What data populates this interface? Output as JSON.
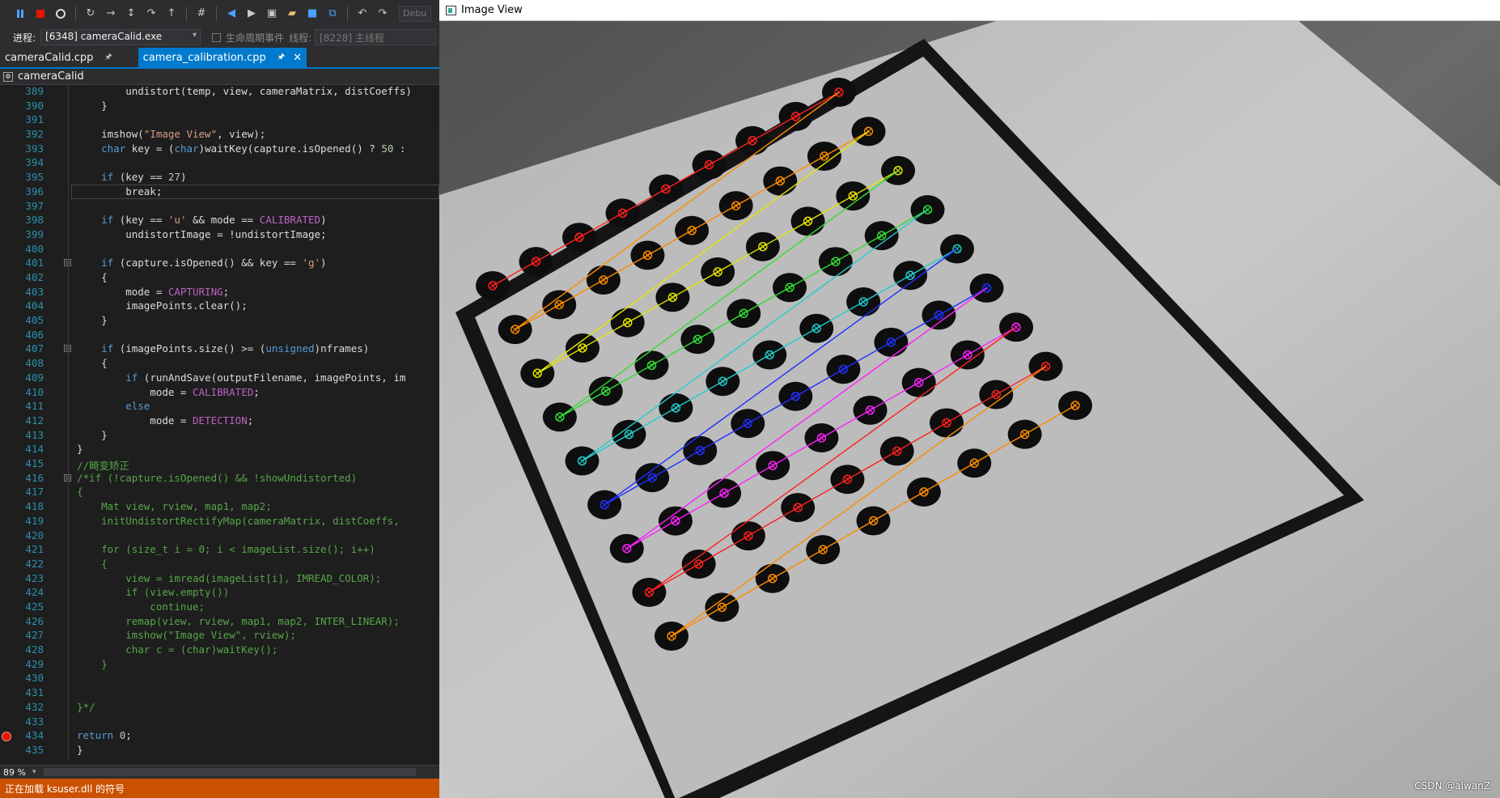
{
  "toolbar": {
    "icons": [
      "pause-icon",
      "stop-icon",
      "restart-icon",
      "show-next-statement-icon",
      "step-into-icon",
      "step-over-icon",
      "step-out-icon",
      "hex-icon",
      "navigate-back-icon",
      "navigate-forward-icon",
      "new-project-icon",
      "open-file-icon",
      "save-icon",
      "save-all-icon",
      "undo-icon",
      "redo-icon"
    ],
    "config_value": "Debu"
  },
  "process_bar": {
    "process_label": "进程:",
    "process_value": "[6348] cameraCalid.exe",
    "lifecycle_label": "生命周期事件",
    "thread_label": "线程:",
    "thread_value": "[8228] 主线程"
  },
  "tabs": [
    {
      "label": "cameraCalid.cpp",
      "active": false
    },
    {
      "label": "camera_calibration.cpp",
      "active": true
    }
  ],
  "navbar": {
    "scope": "cameraCalid"
  },
  "editor": {
    "lines": [
      {
        "n": "389",
        "text": "        undistort(temp, view, cameraMatrix, distCoeffs)"
      },
      {
        "n": "390",
        "text": "    }"
      },
      {
        "n": "391",
        "text": ""
      },
      {
        "n": "392",
        "text": "    imshow(\"Image View\", view);"
      },
      {
        "n": "393",
        "text": "    char key = (char)waitKey(capture.isOpened() ? 50 :"
      },
      {
        "n": "394",
        "text": ""
      },
      {
        "n": "395",
        "text": "    if (key == 27)"
      },
      {
        "n": "396",
        "text": "        break;"
      },
      {
        "n": "397",
        "text": ""
      },
      {
        "n": "398",
        "text": "    if (key == 'u' && mode == CALIBRATED)"
      },
      {
        "n": "399",
        "text": "        undistortImage = !undistortImage;"
      },
      {
        "n": "400",
        "text": ""
      },
      {
        "n": "401",
        "text": "    if (capture.isOpened() && key == 'g')"
      },
      {
        "n": "402",
        "text": "    {"
      },
      {
        "n": "403",
        "text": "        mode = CAPTURING;"
      },
      {
        "n": "404",
        "text": "        imagePoints.clear();"
      },
      {
        "n": "405",
        "text": "    }"
      },
      {
        "n": "406",
        "text": ""
      },
      {
        "n": "407",
        "text": "    if (imagePoints.size() >= (unsigned)nframes)"
      },
      {
        "n": "408",
        "text": "    {"
      },
      {
        "n": "409",
        "text": "        if (runAndSave(outputFilename, imagePoints, im"
      },
      {
        "n": "410",
        "text": "            mode = CALIBRATED;"
      },
      {
        "n": "411",
        "text": "        else"
      },
      {
        "n": "412",
        "text": "            mode = DETECTION;"
      },
      {
        "n": "413",
        "text": "    }"
      },
      {
        "n": "414",
        "text": "}"
      },
      {
        "n": "415",
        "text": "//畸变矫正"
      },
      {
        "n": "416",
        "text": "/*if (!capture.isOpened() && !showUndistorted)"
      },
      {
        "n": "417",
        "text": "{"
      },
      {
        "n": "418",
        "text": "    Mat view, rview, map1, map2;"
      },
      {
        "n": "419",
        "text": "    initUndistortRectifyMap(cameraMatrix, distCoeffs,"
      },
      {
        "n": "420",
        "text": ""
      },
      {
        "n": "421",
        "text": "    for (size_t i = 0; i < imageList.size(); i++)"
      },
      {
        "n": "422",
        "text": "    {"
      },
      {
        "n": "423",
        "text": "        view = imread(imageList[i], IMREAD_COLOR);"
      },
      {
        "n": "424",
        "text": "        if (view.empty())"
      },
      {
        "n": "425",
        "text": "            continue;"
      },
      {
        "n": "426",
        "text": "        remap(view, rview, map1, map2, INTER_LINEAR);"
      },
      {
        "n": "427",
        "text": "        imshow(\"Image View\", rview);"
      },
      {
        "n": "428",
        "text": "        char c = (char)waitKey();"
      },
      {
        "n": "429",
        "text": "    }"
      },
      {
        "n": "430",
        "text": ""
      },
      {
        "n": "431",
        "text": ""
      },
      {
        "n": "432",
        "text": "}*/"
      },
      {
        "n": "433",
        "text": ""
      },
      {
        "n": "434",
        "text": "return 0;"
      },
      {
        "n": "435",
        "text": "}"
      }
    ]
  },
  "zoom": {
    "value": "89 %"
  },
  "status": {
    "text": "正在加载 ksuser.dll 的符号"
  },
  "image_window": {
    "title": "Image View",
    "watermark": "CSDN @alwanZ",
    "row_colors": [
      "#ff2020",
      "#ff8c00",
      "#e6e600",
      "#33dd33",
      "#22cccc",
      "#2030ff",
      "#ff20ff",
      "#ff2020",
      "#ff8c00"
    ]
  }
}
